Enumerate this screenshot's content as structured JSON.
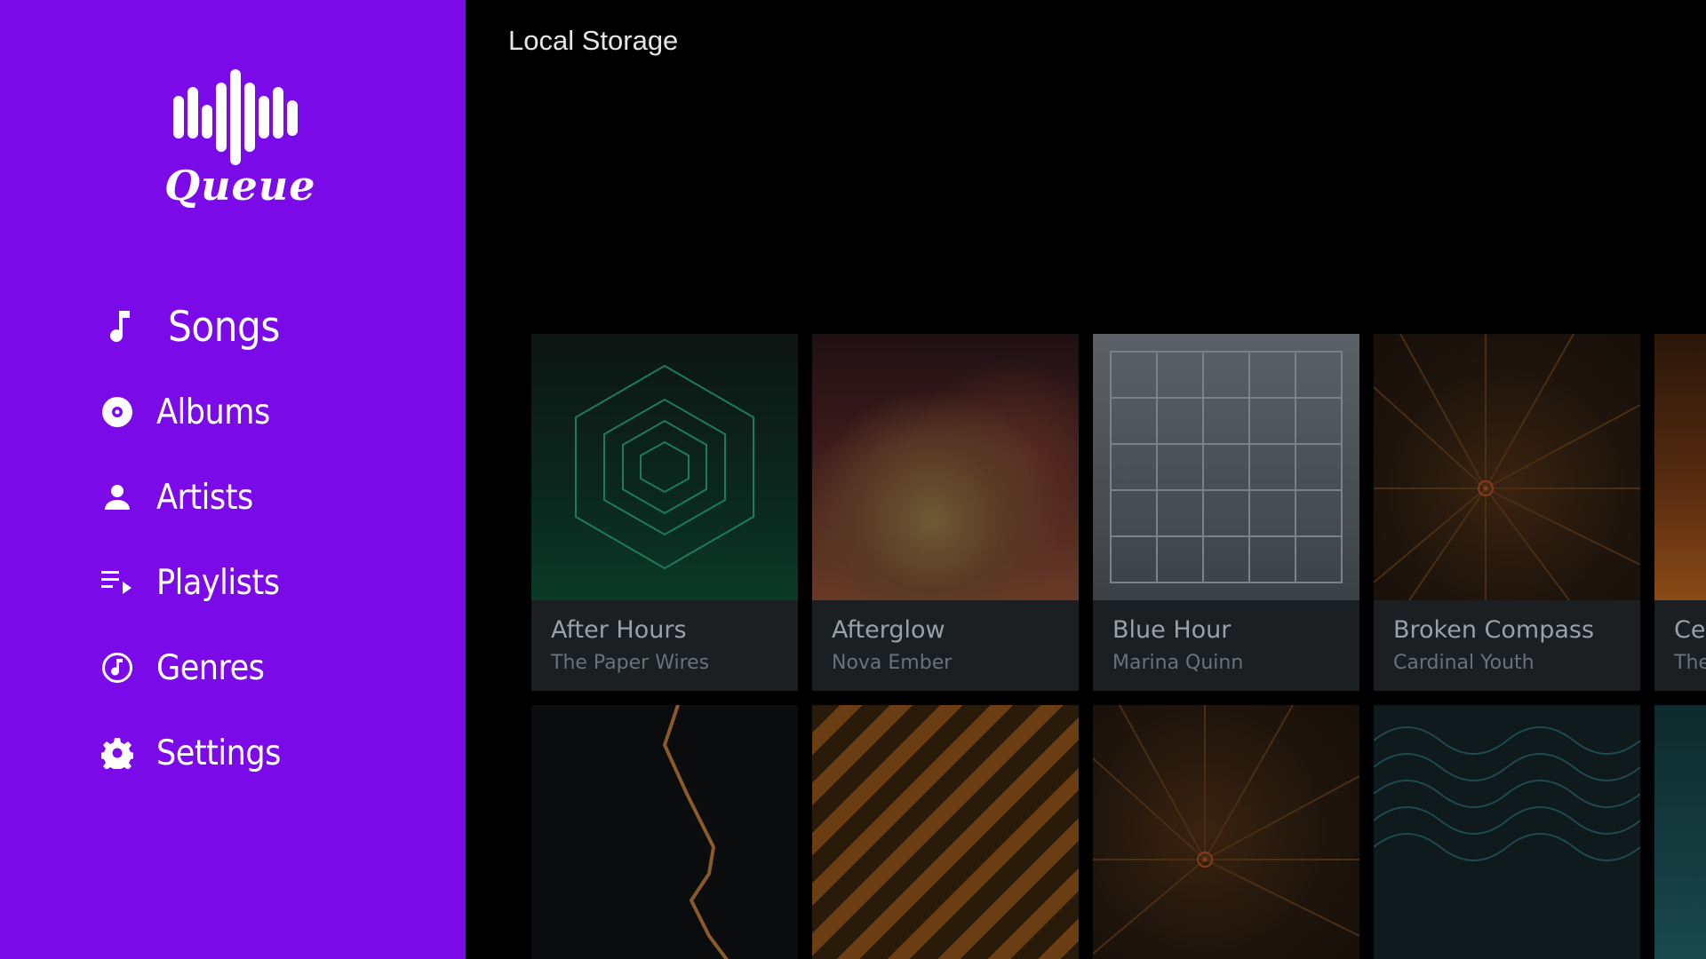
{
  "app": {
    "logo_text": "Queue"
  },
  "sidebar": {
    "items": [
      {
        "label": "Songs",
        "icon": "music-note-icon"
      },
      {
        "label": "Albums",
        "icon": "album-disc-icon"
      },
      {
        "label": "Artists",
        "icon": "person-icon"
      },
      {
        "label": "Playlists",
        "icon": "playlist-icon"
      },
      {
        "label": "Genres",
        "icon": "genre-icon"
      },
      {
        "label": "Settings",
        "icon": "gear-icon"
      }
    ],
    "active": "Songs"
  },
  "main": {
    "title": "Local Storage",
    "albums": [
      {
        "title": "After Hours",
        "artist": "The Paper Wires"
      },
      {
        "title": "Afterglow",
        "artist": "Nova Ember"
      },
      {
        "title": "Blue Hour",
        "artist": "Marina Quinn"
      },
      {
        "title": "Broken Compass",
        "artist": "Cardinal Youth"
      },
      {
        "title": "Ced",
        "artist": "The"
      }
    ]
  },
  "colors": {
    "sidebar_bg": "#7a0ae8",
    "main_bg": "#000000",
    "card_bg": "#1b1f22"
  }
}
